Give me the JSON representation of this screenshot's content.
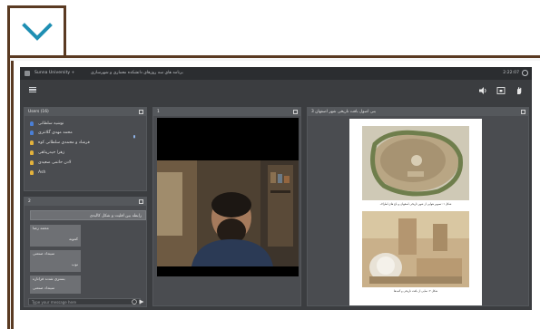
{
  "app": {
    "brand": "Sunna University +",
    "title": "برنامه های سه روزهای دانشکده معماری و شهرسازی",
    "clock": "2:22:07"
  },
  "users_panel": {
    "title": "Users (16)",
    "users": [
      {
        "name": "نوشیه سلطانی",
        "color": "#4a7fd6"
      },
      {
        "name": "محمد مهدی گلانتری",
        "color": "#4a7fd6"
      },
      {
        "name": "فرشاد و محمدی سلطانی کوه",
        "color": "#e3b23c"
      },
      {
        "name": "زهرا حیدرپناهی",
        "color": "#e3b23c"
      },
      {
        "name": "لادن حاتمی صعیدی",
        "color": "#e3b23c"
      },
      {
        "name": "Ash",
        "color": "#e3b23c"
      }
    ]
  },
  "chat_panel": {
    "title": "2",
    "messages": [
      {
        "text": "رابطه بین اقلیت و شکل کالبدی",
        "side": "right"
      },
      {
        "text": "محمد رضا",
        "side": "left"
      },
      {
        "text": "کمونه",
        "side": "left"
      },
      {
        "text": "سینداد صنعتی",
        "side": "left"
      },
      {
        "text": "نوب",
        "side": "left"
      },
      {
        "text": "بستری شدند فراتاره",
        "side": "left"
      },
      {
        "text": "سینداد صنعتی",
        "side": "left"
      }
    ],
    "input_placeholder": "Type your message here"
  },
  "video_panel": {
    "title": "1"
  },
  "document_panel": {
    "title": "بنی اصول بافت تاریخی شهر اصفهان 3",
    "caption_top": "شکل ۱: تصویر هوایی از شهر تاریخی اصفهان و باغ های اطراف",
    "caption_bottom": "شکل ۲: نمایی از بافت تاریخی و گنبدها"
  },
  "colors": {
    "frame_brown": "#5a3a22",
    "app_bg": "#3b3d40",
    "panel_bg": "#4a4c50"
  }
}
